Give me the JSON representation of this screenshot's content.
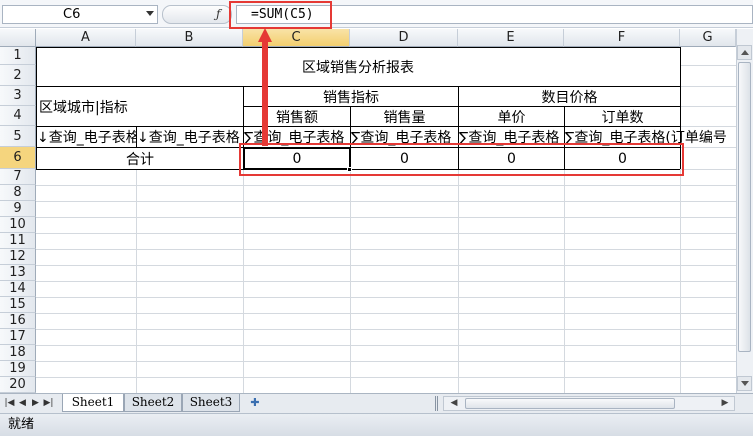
{
  "name_box": "C6",
  "formula_icon": "fx-icon",
  "formula": "=SUM(C5)",
  "columns": [
    "A",
    "B",
    "C",
    "D",
    "E",
    "F",
    "G"
  ],
  "rows": [
    "1",
    "2",
    "3",
    "4",
    "5",
    "6",
    "7",
    "8",
    "9",
    "10",
    "11",
    "12",
    "13",
    "14",
    "15",
    "16",
    "17",
    "18",
    "19",
    "20"
  ],
  "report": {
    "title": "区域销售分析报表",
    "region_header": "区域城市|指标",
    "group1": "销售指标",
    "group2": "数目价格",
    "sub_headers": [
      "销售额",
      "销售量",
      "单价",
      "订单数"
    ],
    "row5": [
      "↓查询_电子表格",
      "↓查询_电子表格",
      "∑查询_电子表格",
      "∑查询_电子表格",
      "∑查询_电子表格",
      "∑查询_电子表格(订单编号"
    ],
    "total_label": "合计",
    "totals": [
      "0",
      "0",
      "0",
      "0"
    ]
  },
  "sheets": [
    "Sheet1",
    "Sheet2",
    "Sheet3"
  ],
  "status": "就绪",
  "highlight_color": "#e53935"
}
